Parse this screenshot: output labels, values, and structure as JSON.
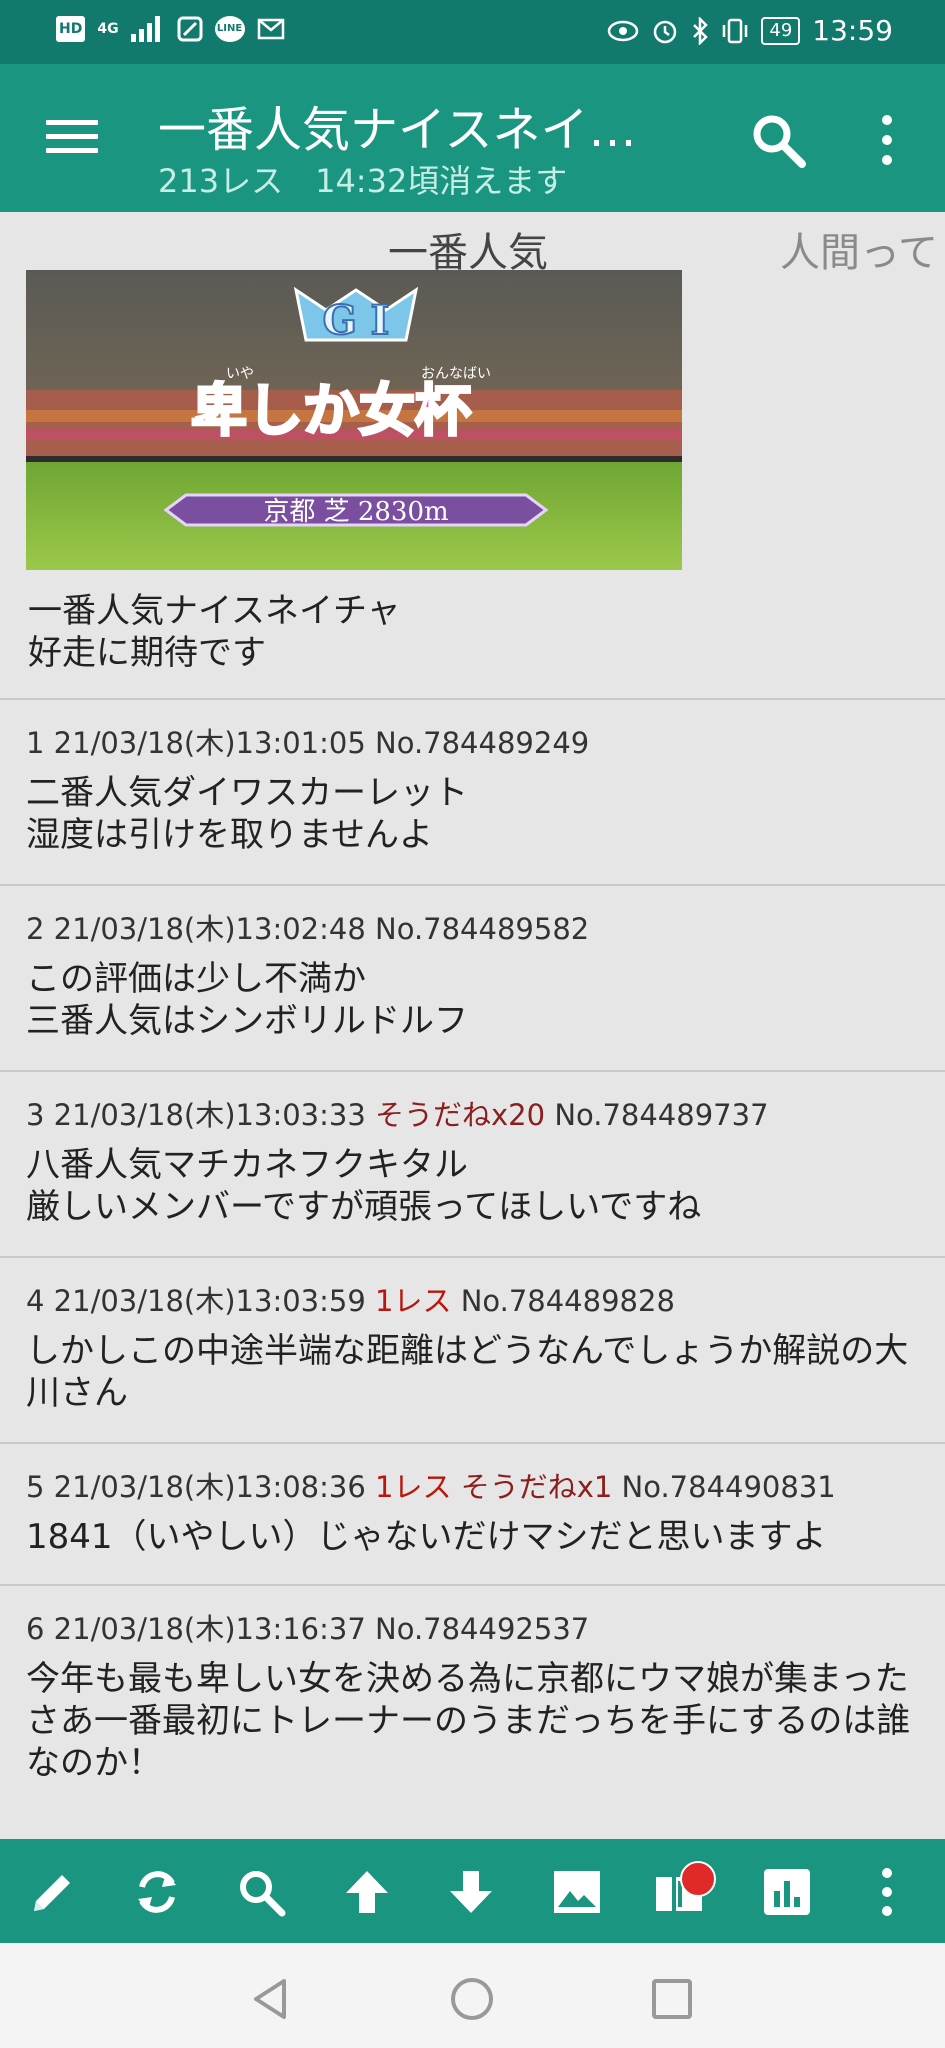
{
  "status_bar": {
    "left_icons": [
      "HD",
      "4G",
      "signal-icon",
      "app-icon",
      "LINE",
      "mail-icon"
    ],
    "battery": "49",
    "time": "13:59"
  },
  "app_bar": {
    "title": "一番人気ナイスネイ…",
    "subtitle": "213レス　14:32頃消えます"
  },
  "thread": {
    "marquee_text": "一番人気",
    "marquee_text_2": "人間って",
    "banner": {
      "emblem": "G I",
      "ruby_left": "いや",
      "ruby_right": "おんなばい",
      "race_name": "卑しか女杯",
      "course": "京都 芝 2830m"
    },
    "op_body": "一番人気ナイスネイチャ\n好走に期待です"
  },
  "posts": [
    {
      "num": "1",
      "date": "21/03/18(木)13:01:05",
      "res": "",
      "soudane": "",
      "no": "No.784489249",
      "body": "二番人気ダイワスカーレット\n湿度は引けを取りませんよ"
    },
    {
      "num": "2",
      "date": "21/03/18(木)13:02:48",
      "res": "",
      "soudane": "",
      "no": "No.784489582",
      "body": "この評価は少し不満か\n三番人気はシンボリルドルフ"
    },
    {
      "num": "3",
      "date": "21/03/18(木)13:03:33",
      "res": "",
      "soudane": "そうだねx20",
      "no": "No.784489737",
      "body": "八番人気マチカネフクキタル\n厳しいメンバーですが頑張ってほしいですね"
    },
    {
      "num": "4",
      "date": "21/03/18(木)13:03:59",
      "res": "1レス",
      "soudane": "",
      "no": "No.784489828",
      "body": "しかしこの中途半端な距離はどうなんでしょうか解説の大川さん"
    },
    {
      "num": "5",
      "date": "21/03/18(木)13:08:36",
      "res": "1レス",
      "soudane": "そうだねx1",
      "no": "No.784490831",
      "body": "1841（いやしい）じゃないだけマシだと思いますよ"
    },
    {
      "num": "6",
      "date": "21/03/18(木)13:16:37",
      "res": "",
      "soudane": "",
      "no": "No.784492537",
      "body": "今年も最も卑しい女を決める為に京都にウマ娘が集まった\nさあ一番最初にトレーナーのうまだっちを手にするのは誰なのか！"
    }
  ],
  "toolbar": {
    "items": [
      "pencil-icon",
      "refresh-icon",
      "search-icon",
      "arrow-up-icon",
      "arrow-down-icon",
      "image-icon",
      "book-icon",
      "bar-chart-icon",
      "more-vert-icon"
    ]
  },
  "nav_bar": {
    "items": [
      "back-icon",
      "home-icon",
      "recents-icon"
    ]
  },
  "colors": {
    "status_bar": "#127a6c",
    "app_bar": "#1a9580",
    "accent_red": "#b8160f",
    "soudane": "#8b1e1e",
    "background": "#e6e6e6"
  }
}
